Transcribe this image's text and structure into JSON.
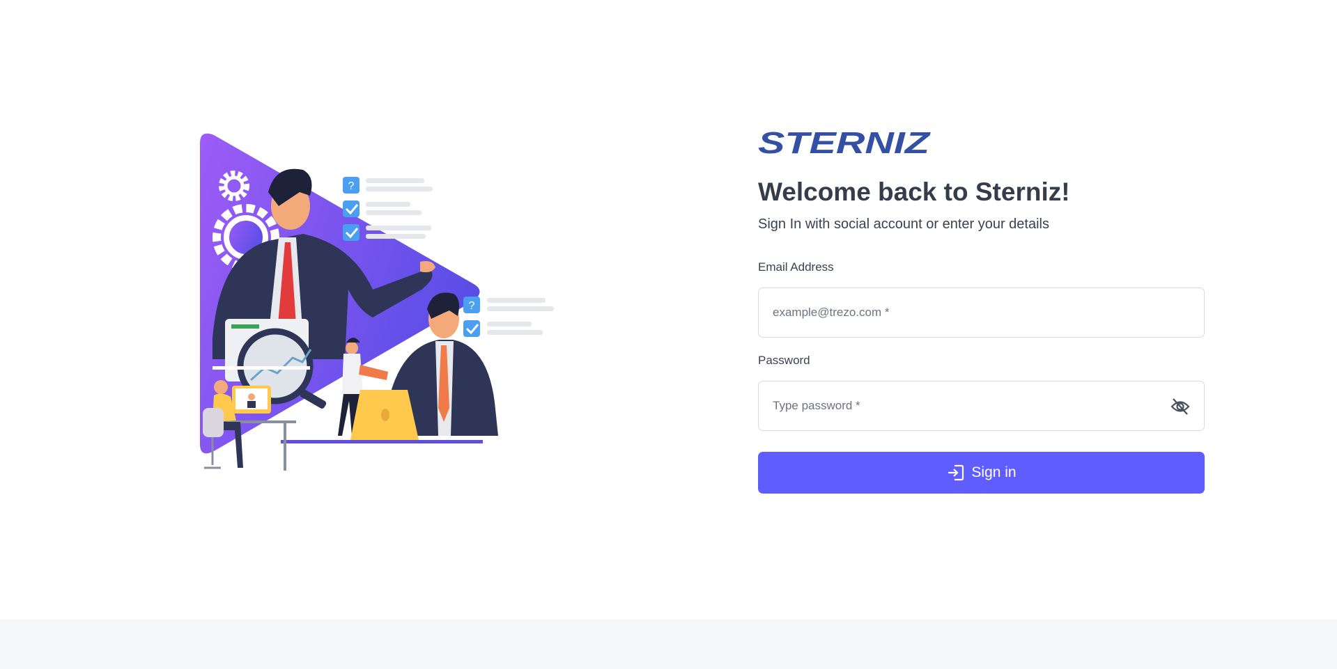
{
  "brand": {
    "logo_text": "STERNIZ",
    "logo_color": "#3450a5",
    "accent": "#605dff"
  },
  "heading": {
    "title": "Welcome back to Sterniz!",
    "subtitle": "Sign In with social account or enter your details"
  },
  "form": {
    "email": {
      "label": "Email Address",
      "placeholder": "example@trezo.com *",
      "value": ""
    },
    "password": {
      "label": "Password",
      "placeholder": "Type password *",
      "value": "",
      "toggle_icon": "eye-off-icon"
    },
    "submit": {
      "label": "Sign in",
      "icon": "login-icon"
    }
  }
}
